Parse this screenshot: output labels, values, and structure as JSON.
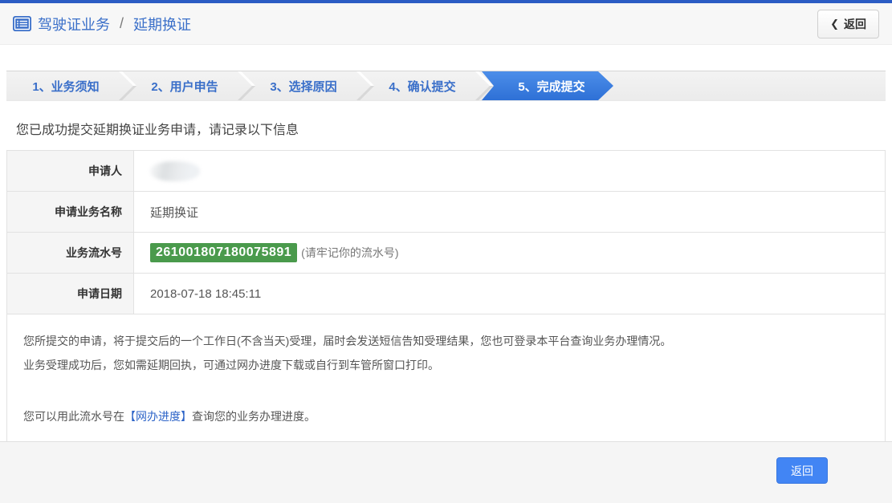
{
  "header": {
    "title_primary": "驾驶证业务",
    "title_separator": "/",
    "title_secondary": "延期换证",
    "back_icon": "❮",
    "back_label": "返回"
  },
  "steps": [
    {
      "label": "1、业务须知",
      "active": false
    },
    {
      "label": "2、用户申告",
      "active": false
    },
    {
      "label": "3、选择原因",
      "active": false
    },
    {
      "label": "4、确认提交",
      "active": false
    },
    {
      "label": "5、完成提交",
      "active": true
    }
  ],
  "result": {
    "message": "您已成功提交延期换证业务申请，请记录以下信息",
    "fields": [
      {
        "label": "申请人",
        "value": "",
        "redacted": true
      },
      {
        "label": "申请业务名称",
        "value": "延期换证"
      },
      {
        "label": "业务流水号",
        "value": "261001807180075891",
        "note": "(请牢记你的流水号)"
      },
      {
        "label": "申请日期",
        "value": "2018-07-18 18:45:11"
      }
    ],
    "notes": [
      "您所提交的申请，将于提交后的一个工作日(不含当天)受理，届时会发送短信告知受理结果，您也可登录本平台查询业务办理情况。",
      "业务受理成功后，您如需延期回执，可通过网办进度下载或自行到车管所窗口打印。"
    ],
    "progress_line": {
      "prefix": "您可以用此流水号在",
      "link": "【网办进度】",
      "suffix": "查询您的业务办理进度。"
    }
  },
  "footer": {
    "back_label": "返回"
  },
  "colors": {
    "top_strip": "#2b5cc4",
    "accent_blue": "#3a6fc9",
    "active_step_blue": "#2e70d6",
    "serial_green": "#4a9a4c",
    "button_blue": "#4285f4"
  }
}
